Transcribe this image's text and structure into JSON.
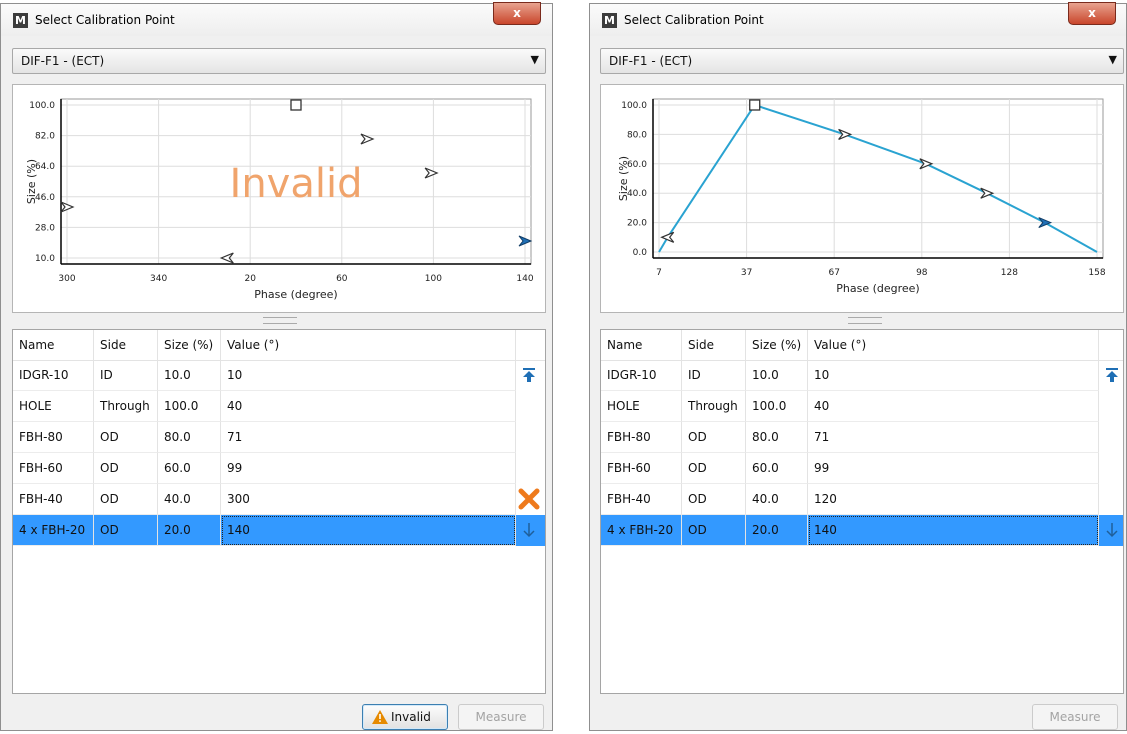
{
  "windows": [
    {
      "title": "Select Calibration Point",
      "close_glyph": "x",
      "app_icon": "M",
      "combo": {
        "value": "DIF-F1 - (ECT)",
        "arrow": "▼"
      },
      "chart_data": {
        "type": "scatter",
        "xlabel": "Phase (degree)",
        "ylabel": "Size (%)",
        "x_ticks": [
          "300",
          "340",
          "20",
          "60",
          "100",
          "140"
        ],
        "y_ticks": [
          "100.0",
          "82.0",
          "64.0",
          "46.0",
          "28.0",
          "10.0"
        ],
        "ylim": [
          10,
          100
        ],
        "overlay_text": "Invalid",
        "grid": true,
        "points": [
          {
            "name": "IDGR-10",
            "x": 10,
            "y": 10,
            "marker": "arrow-left",
            "color": "#333333"
          },
          {
            "name": "HOLE",
            "x": 40,
            "y": 100,
            "marker": "square",
            "color": "#333333"
          },
          {
            "name": "FBH-80",
            "x": 71,
            "y": 80,
            "marker": "arrow-right",
            "color": "#333333"
          },
          {
            "name": "FBH-60",
            "x": 99,
            "y": 60,
            "marker": "arrow-right",
            "color": "#333333"
          },
          {
            "name": "FBH-40",
            "x": 300,
            "y": 40,
            "marker": "arrow-right",
            "color": "#333333"
          },
          {
            "name": "4 x FBH-20",
            "x": 140,
            "y": 20,
            "marker": "arrow-right-filled",
            "color": "#1f6fb5"
          }
        ]
      },
      "table": {
        "columns": [
          "Name",
          "Side",
          "Size (%)",
          "Value (°)"
        ],
        "rows": [
          {
            "name": "IDGR-10",
            "side": "ID",
            "size": "10.0",
            "value": "10",
            "icon": "move-to-top-icon",
            "selected": false
          },
          {
            "name": "HOLE",
            "side": "Through",
            "size": "100.0",
            "value": "40",
            "icon": "",
            "selected": false
          },
          {
            "name": "FBH-80",
            "side": "OD",
            "size": "80.0",
            "value": "71",
            "icon": "",
            "selected": false
          },
          {
            "name": "FBH-60",
            "side": "OD",
            "size": "60.0",
            "value": "99",
            "icon": "",
            "selected": false
          },
          {
            "name": "FBH-40",
            "side": "OD",
            "size": "40.0",
            "value": "300",
            "icon": "error-x-icon",
            "selected": false
          },
          {
            "name": "4 x FBH-20",
            "side": "OD",
            "size": "20.0",
            "value": "140",
            "icon": "move-down-icon",
            "selected": true
          }
        ]
      },
      "buttons": {
        "invalid_label": "Invalid",
        "measure_label": "Measure"
      }
    },
    {
      "title": "Select Calibration Point",
      "close_glyph": "x",
      "app_icon": "M",
      "combo": {
        "value": "DIF-F1 - (ECT)",
        "arrow": "▼"
      },
      "chart_data": {
        "type": "line",
        "xlabel": "Phase (degree)",
        "ylabel": "Size (%)",
        "x_ticks": [
          "7",
          "37",
          "67",
          "98",
          "128",
          "158"
        ],
        "y_ticks": [
          "100.0",
          "80.0",
          "60.0",
          "40.0",
          "20.0",
          "0.0"
        ],
        "xlim": [
          7,
          158
        ],
        "ylim": [
          0,
          100
        ],
        "grid": true,
        "line_color": "#2aa3d1",
        "line": [
          {
            "x": 7,
            "y": 0
          },
          {
            "x": 10,
            "y": 10
          },
          {
            "x": 40,
            "y": 100
          },
          {
            "x": 71,
            "y": 80
          },
          {
            "x": 99,
            "y": 60
          },
          {
            "x": 120,
            "y": 40
          },
          {
            "x": 140,
            "y": 20
          },
          {
            "x": 158,
            "y": 0
          }
        ],
        "points": [
          {
            "name": "IDGR-10",
            "x": 10,
            "y": 10,
            "marker": "arrow-left",
            "color": "#333333"
          },
          {
            "name": "HOLE",
            "x": 40,
            "y": 100,
            "marker": "square",
            "color": "#333333"
          },
          {
            "name": "FBH-80",
            "x": 71,
            "y": 80,
            "marker": "arrow-right",
            "color": "#333333"
          },
          {
            "name": "FBH-60",
            "x": 99,
            "y": 60,
            "marker": "arrow-right",
            "color": "#333333"
          },
          {
            "name": "FBH-40",
            "x": 120,
            "y": 40,
            "marker": "arrow-right",
            "color": "#333333"
          },
          {
            "name": "4 x FBH-20",
            "x": 140,
            "y": 20,
            "marker": "arrow-right-filled",
            "color": "#1f6fb5"
          }
        ]
      },
      "table": {
        "columns": [
          "Name",
          "Side",
          "Size (%)",
          "Value (°)"
        ],
        "rows": [
          {
            "name": "IDGR-10",
            "side": "ID",
            "size": "10.0",
            "value": "10",
            "icon": "move-to-top-icon",
            "selected": false
          },
          {
            "name": "HOLE",
            "side": "Through",
            "size": "100.0",
            "value": "40",
            "icon": "",
            "selected": false
          },
          {
            "name": "FBH-80",
            "side": "OD",
            "size": "80.0",
            "value": "71",
            "icon": "",
            "selected": false
          },
          {
            "name": "FBH-60",
            "side": "OD",
            "size": "60.0",
            "value": "99",
            "icon": "",
            "selected": false
          },
          {
            "name": "FBH-40",
            "side": "OD",
            "size": "40.0",
            "value": "120",
            "icon": "",
            "selected": false
          },
          {
            "name": "4 x FBH-20",
            "side": "OD",
            "size": "20.0",
            "value": "140",
            "icon": "move-down-icon",
            "selected": true
          }
        ]
      },
      "buttons": {
        "measure_label": "Measure"
      }
    }
  ],
  "colors": {
    "selection": "#3399ff",
    "invalid_text": "#f0a46c",
    "error_icon": "#ee7a1c",
    "warning_icon": "#e68a00",
    "blue_icon": "#1f6fb5"
  }
}
